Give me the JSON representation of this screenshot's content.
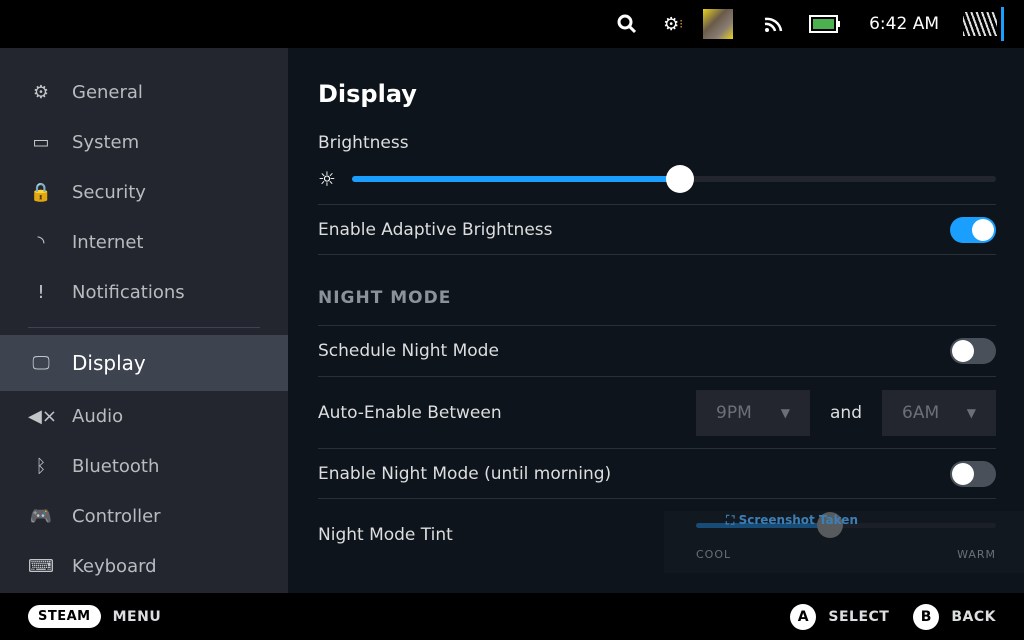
{
  "topbar": {
    "time": "6:42 AM",
    "icons": [
      "search-icon",
      "gear-notification-icon",
      "game-thumbnail",
      "wifi-icon",
      "battery-icon",
      "avatar"
    ],
    "battery_color": "#4caf50"
  },
  "sidebar": {
    "items": [
      {
        "label": "General",
        "icon": "gear-icon",
        "glyph": "⚙"
      },
      {
        "label": "System",
        "icon": "system-icon",
        "glyph": "▭"
      },
      {
        "label": "Security",
        "icon": "lock-icon",
        "glyph": "🔒"
      },
      {
        "label": "Internet",
        "icon": "wifi-icon",
        "glyph": "◝"
      },
      {
        "label": "Notifications",
        "icon": "alert-icon",
        "glyph": "!"
      },
      {
        "label": "Display",
        "icon": "monitor-icon",
        "glyph": "🖵",
        "selected": true
      },
      {
        "label": "Audio",
        "icon": "mute-icon",
        "glyph": "◀×"
      },
      {
        "label": "Bluetooth",
        "icon": "bluetooth-icon",
        "glyph": "ᛒ"
      },
      {
        "label": "Controller",
        "icon": "gamepad-icon",
        "glyph": "🎮"
      },
      {
        "label": "Keyboard",
        "icon": "keyboard-icon",
        "glyph": "⌨"
      }
    ]
  },
  "main": {
    "title": "Display",
    "brightness_label": "Brightness",
    "brightness_value": 0.51,
    "adaptive_label": "Enable Adaptive Brightness",
    "adaptive_on": true,
    "night_section": "NIGHT MODE",
    "schedule_label": "Schedule Night Mode",
    "schedule_on": false,
    "auto_label": "Auto-Enable Between",
    "auto_from": "9PM",
    "auto_and": "and",
    "auto_to": "6AM",
    "enable_label": "Enable Night Mode (until morning)",
    "enable_on": false,
    "tint_label": "Night Mode Tint",
    "tint_value": 0.45,
    "tint_cool": "COOL",
    "tint_warm": "WARM",
    "toast": "Screenshot Taken"
  },
  "bottom": {
    "steam": "STEAM",
    "menu": "MENU",
    "a": "A",
    "select": "SELECT",
    "b": "B",
    "back": "BACK"
  },
  "colors": {
    "accent": "#1a9fff"
  }
}
